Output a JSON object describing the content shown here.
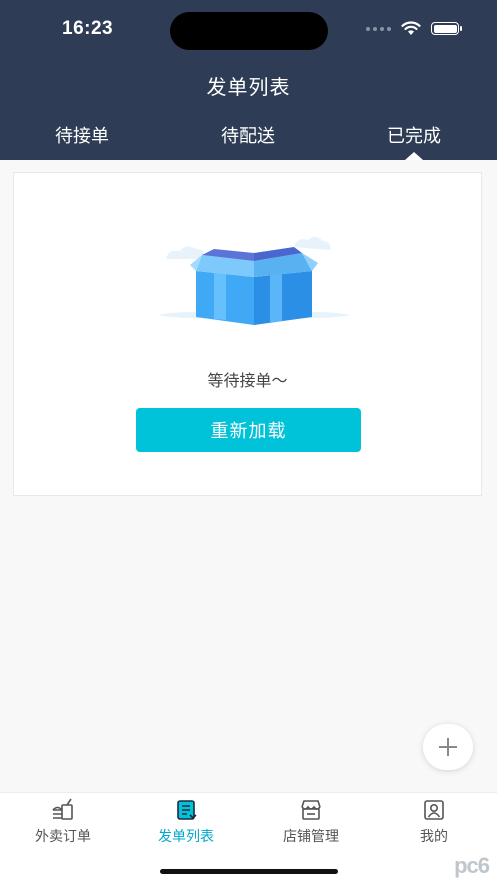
{
  "status_bar": {
    "time": "16:23"
  },
  "header": {
    "title": "发单列表"
  },
  "tabs": [
    {
      "label": "待接单",
      "active": false
    },
    {
      "label": "待配送",
      "active": false
    },
    {
      "label": "已完成",
      "active": true
    }
  ],
  "empty_state": {
    "message": "等待接单～",
    "reload_label": "重新加载",
    "icon": "open-box-illustration"
  },
  "fab": {
    "icon": "plus-icon"
  },
  "bottom_nav": {
    "items": [
      {
        "label": "外卖订单",
        "icon": "takeout-icon",
        "active": false
      },
      {
        "label": "发单列表",
        "icon": "order-list-icon",
        "active": true
      },
      {
        "label": "店铺管理",
        "icon": "store-icon",
        "active": false
      },
      {
        "label": "我的",
        "icon": "profile-icon",
        "active": false
      }
    ]
  },
  "watermark": {
    "text": "pc6"
  },
  "colors": {
    "header_bg": "#2e3d55",
    "accent": "#00c2d8",
    "active_nav": "#00a8cc",
    "page_bg": "#f8f8f8"
  }
}
